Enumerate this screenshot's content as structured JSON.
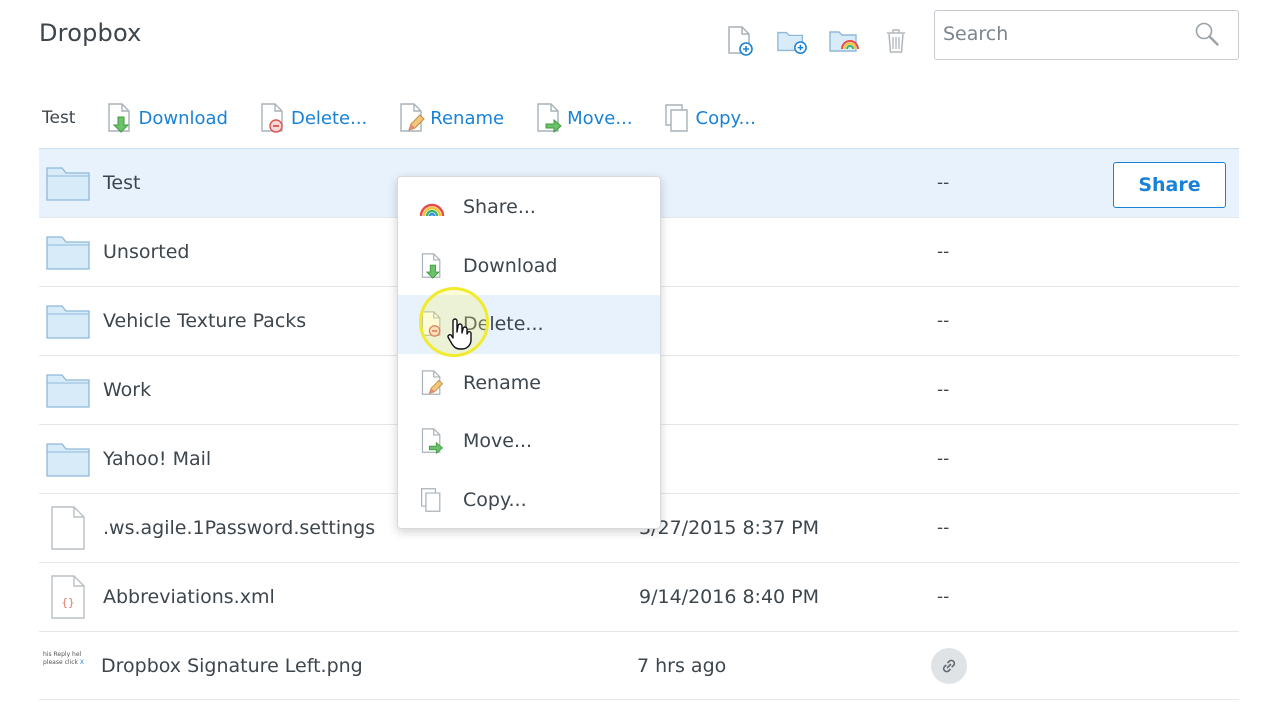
{
  "app": {
    "title": "Dropbox"
  },
  "search": {
    "placeholder": "Search"
  },
  "action_bar": {
    "selected_name": "Test",
    "actions": [
      {
        "label": "Download",
        "icon": "download-icon"
      },
      {
        "label": "Delete...",
        "icon": "delete-icon"
      },
      {
        "label": "Rename",
        "icon": "rename-icon"
      },
      {
        "label": "Move...",
        "icon": "move-icon"
      },
      {
        "label": "Copy...",
        "icon": "copy-icon"
      }
    ]
  },
  "files": [
    {
      "name": "Test",
      "modified": "",
      "members": "--",
      "type": "folder",
      "selected": true
    },
    {
      "name": "Unsorted",
      "modified": "",
      "members": "--",
      "type": "folder"
    },
    {
      "name": "Vehicle Texture Packs",
      "modified": "",
      "members": "--",
      "type": "folder"
    },
    {
      "name": "Work",
      "modified": "",
      "members": "--",
      "type": "folder"
    },
    {
      "name": "Yahoo! Mail",
      "modified": "",
      "members": "--",
      "type": "folder"
    },
    {
      "name": ".ws.agile.1Password.settings",
      "modified": "3/27/2015 8:37 PM",
      "members": "--",
      "type": "file"
    },
    {
      "name": "Abbreviations.xml",
      "modified": "9/14/2016 8:40 PM",
      "members": "--",
      "type": "xml"
    },
    {
      "name": "Dropbox Signature Left.png",
      "modified": "7 hrs ago",
      "members": "",
      "type": "image"
    }
  ],
  "share_button": {
    "label": "Share"
  },
  "thumbnail_text": {
    "line1": "his Reply hel",
    "line2": "please click",
    "line2_link": "X"
  },
  "context_menu": {
    "items": [
      {
        "label": "Share...",
        "icon": "rainbow-share-icon"
      },
      {
        "label": "Download",
        "icon": "download-icon"
      },
      {
        "label": "Delete...",
        "icon": "delete-icon",
        "hover": true
      },
      {
        "label": "Rename",
        "icon": "rename-icon"
      },
      {
        "label": "Move...",
        "icon": "move-icon"
      },
      {
        "label": "Copy...",
        "icon": "copy-icon"
      }
    ]
  },
  "colors": {
    "accent": "#1a82d6",
    "selected_row": "#e7f2fc",
    "text": "#3d464d",
    "folder": "#d8ebf9"
  }
}
